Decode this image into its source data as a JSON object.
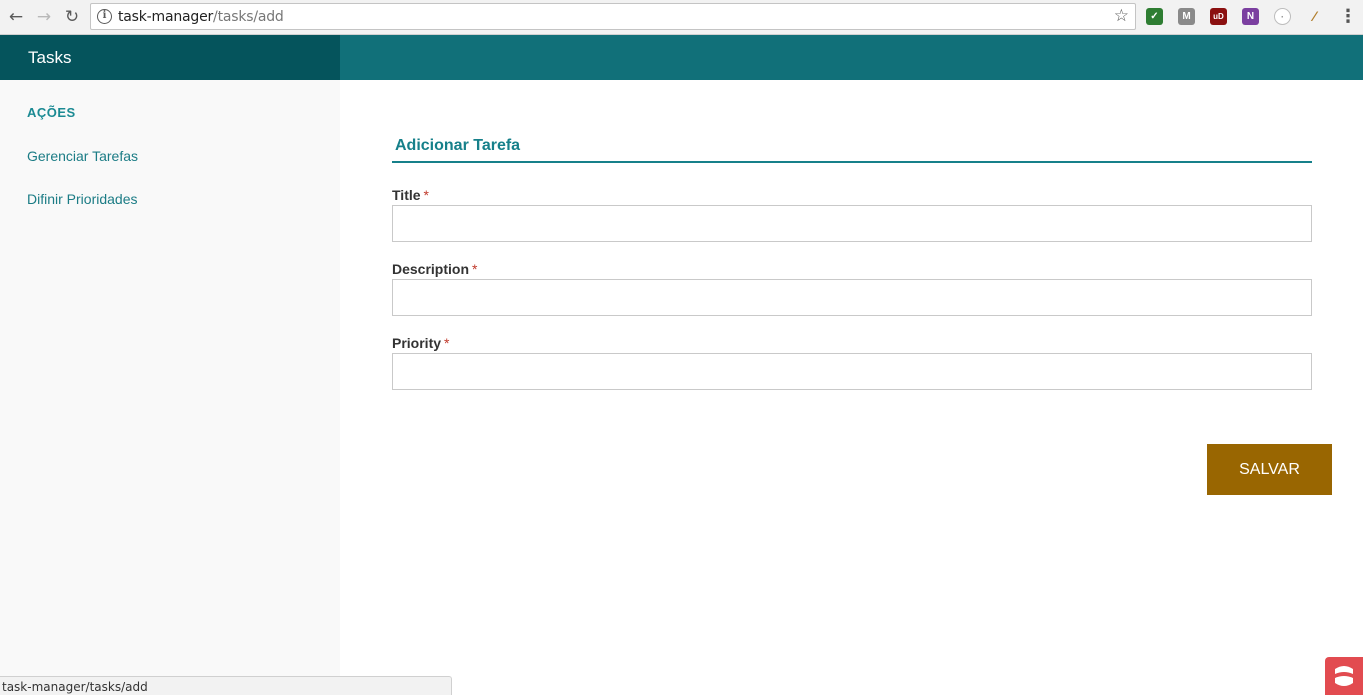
{
  "browser": {
    "url_host": "task-manager",
    "url_path": "/tasks/add",
    "extensions": [
      {
        "name": "checkmark-extension-icon",
        "color": "#2e7d32",
        "glyph": "✓"
      },
      {
        "name": "m-extension-icon",
        "color": "#8a8a8a",
        "glyph": "M"
      },
      {
        "name": "ublock-extension-icon",
        "color": "#8b1010",
        "glyph": "uD"
      },
      {
        "name": "onenote-extension-icon",
        "color": "#7b3fa0",
        "glyph": "N"
      },
      {
        "name": "circle-extension-icon",
        "color": "#cfcfcf",
        "glyph": "·"
      },
      {
        "name": "feather-extension-icon",
        "color": "#b07d2a",
        "glyph": "⁄"
      }
    ]
  },
  "header": {
    "title": "Tasks"
  },
  "sidebar": {
    "heading": "AÇÕES",
    "items": [
      {
        "label": "Gerenciar Tarefas"
      },
      {
        "label": "Difinir Prioridades"
      }
    ]
  },
  "form": {
    "title": "Adicionar Tarefa",
    "required_mark": "*",
    "fields": [
      {
        "label": "Title",
        "value": ""
      },
      {
        "label": "Description",
        "value": ""
      },
      {
        "label": "Priority",
        "value": ""
      }
    ],
    "save_label": "SALVAR"
  },
  "status_bar": {
    "text": "task-manager/tasks/add"
  },
  "colors": {
    "header_bg": "#117079",
    "brand_bg": "#05545c",
    "accent": "#16808a",
    "save_button": "#996601",
    "required": "#c0392b"
  }
}
